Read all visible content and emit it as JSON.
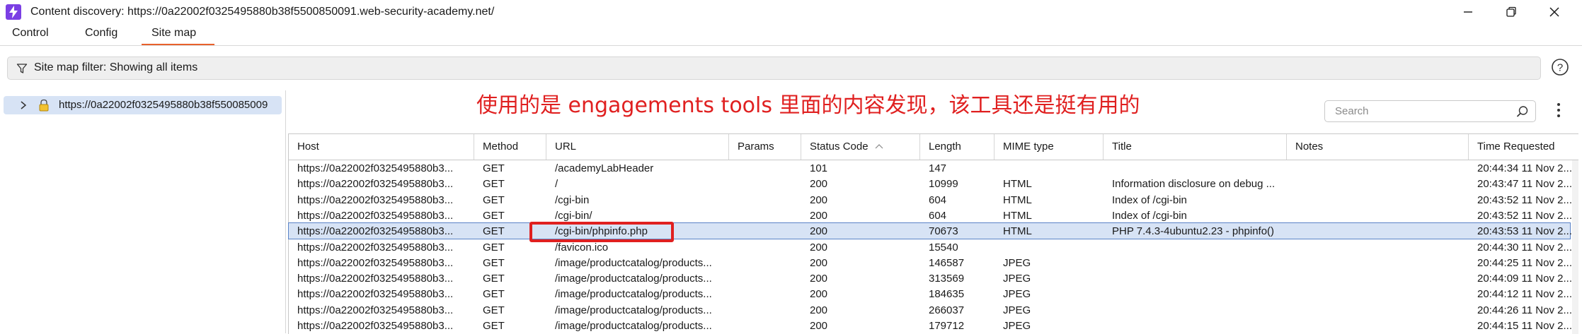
{
  "window": {
    "title": "Content discovery: https://0a22002f0325495880b38f5500850091.web-security-academy.net/"
  },
  "tabs": [
    {
      "label": "Control"
    },
    {
      "label": "Config"
    },
    {
      "label": "Site map",
      "active": true
    }
  ],
  "filter": {
    "text": "Site map filter: Showing all items"
  },
  "tree": {
    "node_label": "https://0a22002f0325495880b38f550085009"
  },
  "annotation": {
    "text": "使用的是 engagements tools 里面的内容发现，该工具还是挺有用的"
  },
  "search": {
    "placeholder": "Search"
  },
  "table": {
    "columns": [
      "Host",
      "Method",
      "URL",
      "Params",
      "Status Code",
      "Length",
      "MIME type",
      "Title",
      "Notes",
      "Time Requested"
    ],
    "sort_column": "Status Code",
    "rows": [
      {
        "host": "https://0a22002f0325495880b3...",
        "method": "GET",
        "url": "/academyLabHeader",
        "params": "",
        "status": "101",
        "length": "147",
        "mime": "",
        "title": "",
        "notes": "",
        "time": "20:44:34 11 Nov 2..."
      },
      {
        "host": "https://0a22002f0325495880b3...",
        "method": "GET",
        "url": "/",
        "params": "",
        "status": "200",
        "length": "10999",
        "mime": "HTML",
        "title": "Information disclosure on debug ...",
        "notes": "",
        "time": "20:43:47 11 Nov 2..."
      },
      {
        "host": "https://0a22002f0325495880b3...",
        "method": "GET",
        "url": "/cgi-bin",
        "params": "",
        "status": "200",
        "length": "604",
        "mime": "HTML",
        "title": "Index of /cgi-bin",
        "notes": "",
        "time": "20:43:52 11 Nov 2..."
      },
      {
        "host": "https://0a22002f0325495880b3...",
        "method": "GET",
        "url": "/cgi-bin/",
        "params": "",
        "status": "200",
        "length": "604",
        "mime": "HTML",
        "title": "Index of /cgi-bin",
        "notes": "",
        "time": "20:43:52 11 Nov 2..."
      },
      {
        "host": "https://0a22002f0325495880b3...",
        "method": "GET",
        "url": "/cgi-bin/phpinfo.php",
        "params": "",
        "status": "200",
        "length": "70673",
        "mime": "HTML",
        "title": "PHP 7.4.3-4ubuntu2.23 - phpinfo()",
        "notes": "",
        "time": "20:43:53 11 Nov 2...",
        "selected": true
      },
      {
        "host": "https://0a22002f0325495880b3...",
        "method": "GET",
        "url": "/favicon.ico",
        "params": "",
        "status": "200",
        "length": "15540",
        "mime": "",
        "title": "",
        "notes": "",
        "time": "20:44:30 11 Nov 2..."
      },
      {
        "host": "https://0a22002f0325495880b3...",
        "method": "GET",
        "url": "/image/productcatalog/products...",
        "params": "",
        "status": "200",
        "length": "146587",
        "mime": "JPEG",
        "title": "",
        "notes": "",
        "time": "20:44:25 11 Nov 2..."
      },
      {
        "host": "https://0a22002f0325495880b3...",
        "method": "GET",
        "url": "/image/productcatalog/products...",
        "params": "",
        "status": "200",
        "length": "313569",
        "mime": "JPEG",
        "title": "",
        "notes": "",
        "time": "20:44:09 11 Nov 2..."
      },
      {
        "host": "https://0a22002f0325495880b3...",
        "method": "GET",
        "url": "/image/productcatalog/products...",
        "params": "",
        "status": "200",
        "length": "184635",
        "mime": "JPEG",
        "title": "",
        "notes": "",
        "time": "20:44:12 11 Nov 2..."
      },
      {
        "host": "https://0a22002f0325495880b3...",
        "method": "GET",
        "url": "/image/productcatalog/products...",
        "params": "",
        "status": "200",
        "length": "266037",
        "mime": "JPEG",
        "title": "",
        "notes": "",
        "time": "20:44:26 11 Nov 2..."
      },
      {
        "host": "https://0a22002f0325495880b3...",
        "method": "GET",
        "url": "/image/productcatalog/products...",
        "params": "",
        "status": "200",
        "length": "179712",
        "mime": "JPEG",
        "title": "",
        "notes": "",
        "time": "20:44:15 11 Nov 2..."
      }
    ]
  },
  "colors": {
    "accent": "#e8612c",
    "selection": "#d7e3f5",
    "annotation": "#e02020",
    "app_icon": "#7b3fe4"
  }
}
